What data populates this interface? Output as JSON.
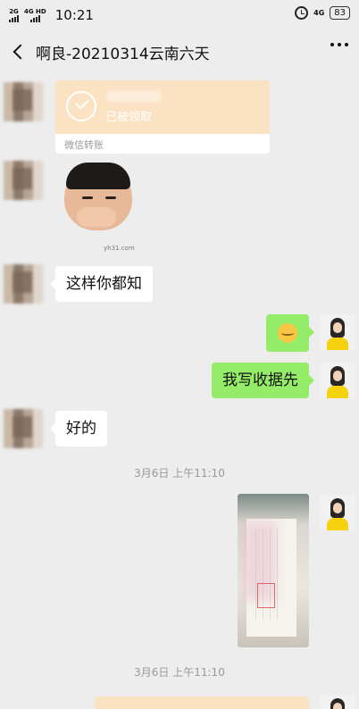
{
  "status_bar": {
    "network_1": "2G",
    "network_2": "4G HD",
    "time": "10:21",
    "network_right": "4G",
    "battery": "83"
  },
  "header": {
    "title": "啊良-20210314云南六天"
  },
  "messages": {
    "transfer_status": "已被领取",
    "transfer_source": "微信转账",
    "sticker_caption": "yh31.com",
    "text_1": "这样你都知",
    "text_2": "我写收据先",
    "text_3": "好的",
    "time_1": "3月6日 上午11:10",
    "time_2": "3月6日 上午11:10"
  },
  "colors": {
    "background": "#ededed",
    "sent_bubble": "#95ec69",
    "received_bubble": "#ffffff",
    "transfer_card": "#fbe2c2"
  }
}
